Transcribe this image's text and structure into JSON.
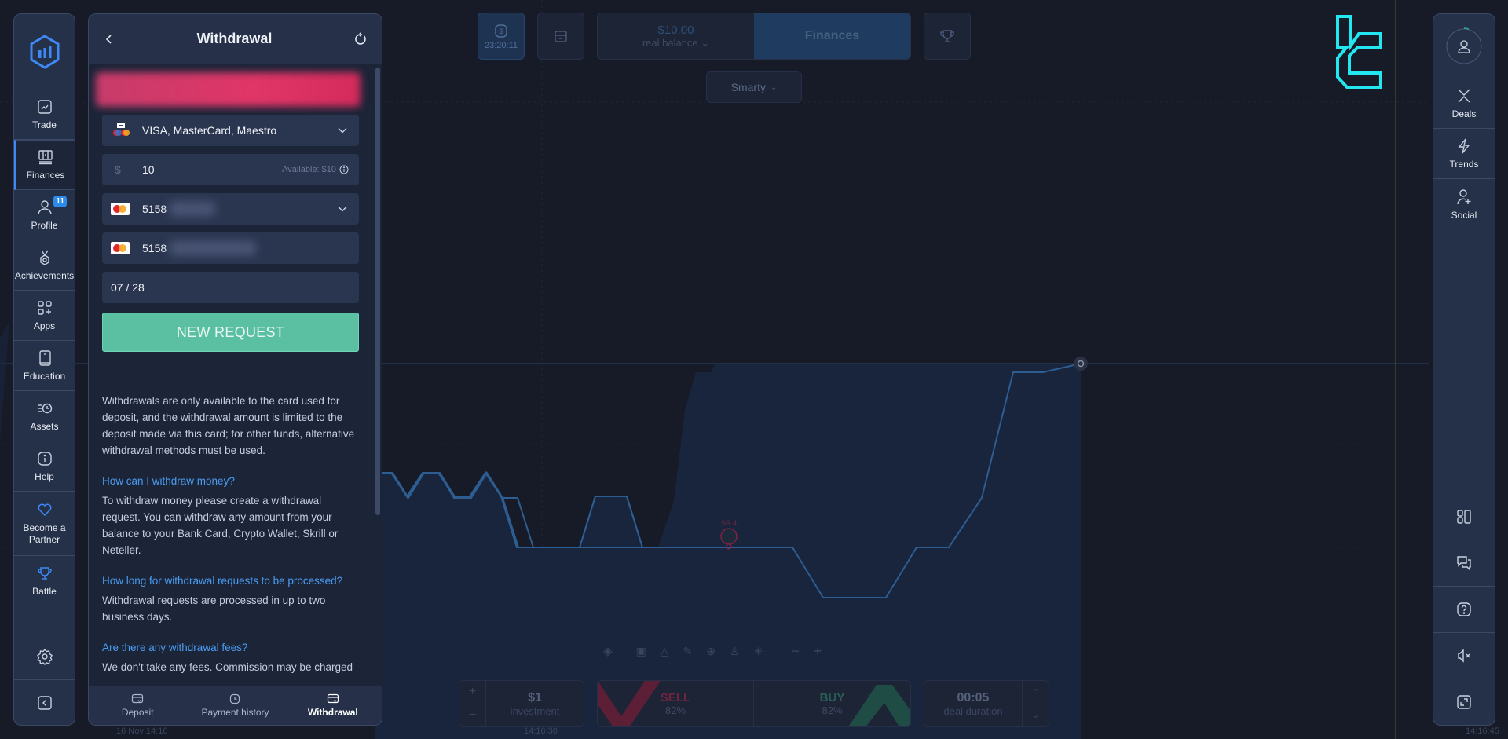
{
  "app": {
    "brand_color": "#3d8af7",
    "accent_green": "#5bbfa2"
  },
  "left_sidebar": {
    "items": [
      {
        "label": "Trade",
        "icon": "chart-line-icon"
      },
      {
        "label": "Finances",
        "icon": "finances-icon",
        "active": true
      },
      {
        "label": "Profile",
        "icon": "user-icon",
        "badge": "11"
      },
      {
        "label": "Achievements",
        "icon": "medal-icon"
      },
      {
        "label": "Apps",
        "icon": "apps-icon"
      },
      {
        "label": "Education",
        "icon": "book-icon"
      },
      {
        "label": "Assets",
        "icon": "assets-clock-icon"
      },
      {
        "label": "Help",
        "icon": "info-icon"
      },
      {
        "label": "Become a Partner",
        "icon": "heart-icon"
      },
      {
        "label": "Battle",
        "icon": "trophy-icon"
      }
    ],
    "settings_icon": "gear-icon",
    "collapse_icon": "chevron-left-icon"
  },
  "panel": {
    "title": "Withdrawal",
    "method": {
      "label": "VISA, MasterCard, Maestro"
    },
    "amount": {
      "currency": "$",
      "value": "10",
      "available": "Available: $10"
    },
    "card_select": {
      "prefix": "5158"
    },
    "card_number": {
      "prefix": "5158"
    },
    "expiry": "07 / 28",
    "submit_label": "NEW REQUEST",
    "info_text": "Withdrawals are only available to the card used for deposit, and the withdrawal amount is limited to the deposit made via this card; for other funds, alternative withdrawal methods must be used.",
    "faq": [
      {
        "q": "How can I withdraw money?",
        "a": "To withdraw money please create a withdrawal request. You can withdraw any amount from your balance to your Bank Card, Crypto Wallet, Skrill or Neteller."
      },
      {
        "q": "How long for withdrawal requests to be processed?",
        "a": "Withdrawal requests are processed in up to two business days."
      },
      {
        "q": "Are there any withdrawal fees?",
        "a": "We don't take any fees. Commission may be charged"
      }
    ],
    "tabs": [
      {
        "label": "Deposit"
      },
      {
        "label": "Payment history"
      },
      {
        "label": "Withdrawal",
        "active": true
      }
    ]
  },
  "topbar": {
    "timer": "23:20:11",
    "balance_amount": "$10.00",
    "balance_label": "real balance",
    "finances_label": "Finances",
    "strategy_label": "Smarty"
  },
  "chart": {
    "marker_label": "SR 4",
    "time_left": "16 Nov 14:16",
    "time_mid": "14:16:30",
    "time_right": "14:16:45"
  },
  "trade_panel": {
    "investment_value": "$1",
    "investment_label": "investment",
    "sell_label": "SELL",
    "sell_pct": "82%",
    "buy_label": "BUY",
    "buy_pct": "82%",
    "duration_value": "00:05",
    "duration_label": "deal duration"
  },
  "right_sidebar": {
    "items": [
      {
        "label": "Deals",
        "icon": "deals-icon"
      },
      {
        "label": "Trends",
        "icon": "lightning-icon"
      },
      {
        "label": "Social",
        "icon": "add-user-icon"
      }
    ]
  }
}
